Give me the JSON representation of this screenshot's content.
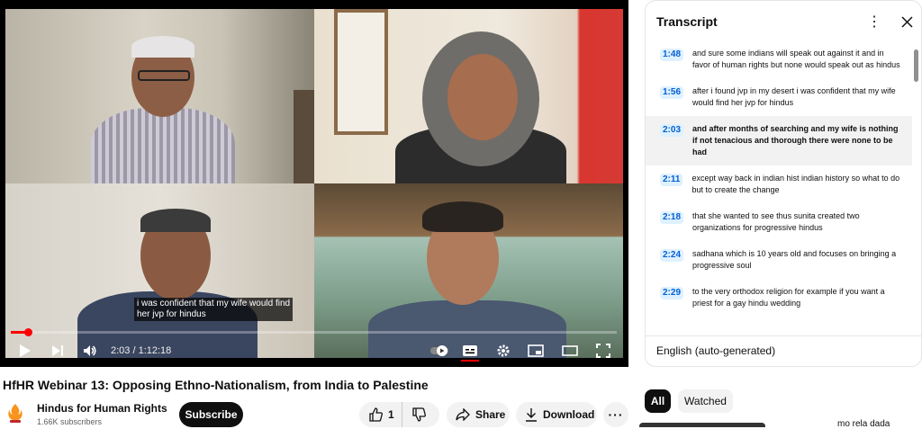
{
  "player": {
    "subtitle_lines": [
      "i was confident that my wife would find",
      "her jvp for hindus"
    ],
    "current_time": "2:03",
    "duration": "1:12:18",
    "time_display": "2:03 / 1:12:18",
    "progress_fraction": 0.028,
    "accent_color": "#ff0000"
  },
  "transcript": {
    "title": "Transcript",
    "language": "English (auto-generated)",
    "segments": [
      {
        "time": "1:48",
        "text": "and sure some indians will speak out against it and in favor of human rights but none would speak out as hindus",
        "active": false
      },
      {
        "time": "1:56",
        "text": "after i found jvp in my desert i was confident that my wife would find her jvp for hindus",
        "active": false
      },
      {
        "time": "2:03",
        "text": "and after months of searching and my wife is nothing if not tenacious and thorough there were none to be had",
        "active": true
      },
      {
        "time": "2:11",
        "text": "except way back in indian hist indian history so what to do but to create the change",
        "active": false
      },
      {
        "time": "2:18",
        "text": "that she wanted to see thus sunita created two organizations for progressive hindus",
        "active": false
      },
      {
        "time": "2:24",
        "text": "sadhana which is 10 years old and focuses on bringing a progressive soul",
        "active": false
      },
      {
        "time": "2:29",
        "text": "to the very orthodox religion for example if you want a priest for a gay hindu wedding",
        "active": false
      }
    ]
  },
  "video": {
    "title": "HfHR Webinar 13: Opposing Ethno-Nationalism, from India to Palestine",
    "channel": "Hindus for Human Rights",
    "subscribers": "1.66K subscribers",
    "subscribe_label": "Subscribe",
    "likes": "1",
    "share_label": "Share",
    "download_label": "Download"
  },
  "related": {
    "chips": [
      "All",
      "Watched"
    ],
    "peek_text": "mo rela dada"
  }
}
